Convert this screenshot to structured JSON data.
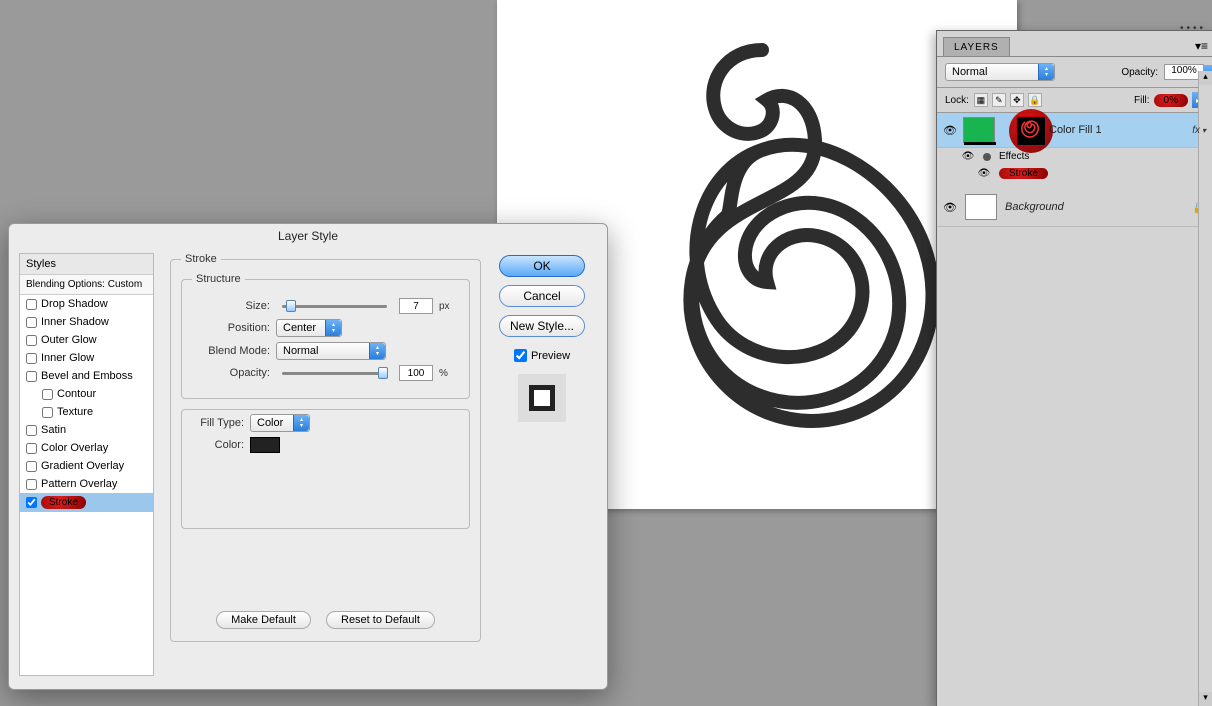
{
  "dialog": {
    "title": "Layer Style",
    "styles_header": "Styles",
    "blending_options": "Blending Options: Custom",
    "style_items": [
      {
        "label": "Drop Shadow",
        "checked": false
      },
      {
        "label": "Inner Shadow",
        "checked": false
      },
      {
        "label": "Outer Glow",
        "checked": false
      },
      {
        "label": "Inner Glow",
        "checked": false
      },
      {
        "label": "Bevel and Emboss",
        "checked": false
      },
      {
        "label": "Contour",
        "checked": false,
        "sub": true
      },
      {
        "label": "Texture",
        "checked": false,
        "sub": true
      },
      {
        "label": "Satin",
        "checked": false
      },
      {
        "label": "Color Overlay",
        "checked": false
      },
      {
        "label": "Gradient Overlay",
        "checked": false
      },
      {
        "label": "Pattern Overlay",
        "checked": false
      }
    ],
    "stroke_item": "Stroke",
    "fieldset_stroke": "Stroke",
    "fieldset_structure": "Structure",
    "size_label": "Size:",
    "size_value": "7",
    "size_unit": "px",
    "position_label": "Position:",
    "position_value": "Center",
    "blendmode_label": "Blend Mode:",
    "blendmode_value": "Normal",
    "opacity_label": "Opacity:",
    "opacity_value": "100",
    "opacity_unit": "%",
    "filltype_label": "Fill Type:",
    "filltype_value": "Color",
    "color_label": "Color:",
    "make_default": "Make Default",
    "reset_default": "Reset to Default",
    "ok": "OK",
    "cancel": "Cancel",
    "new_style": "New Style...",
    "preview": "Preview"
  },
  "layers_panel": {
    "tab": "LAYERS",
    "blend_mode": "Normal",
    "opacity_label": "Opacity:",
    "opacity_value": "100%",
    "lock_label": "Lock:",
    "fill_label": "Fill:",
    "fill_value": "0%",
    "layer1_name": "Color Fill 1",
    "fx": "fx",
    "effects_label": "Effects",
    "stroke_label": "Stroke",
    "background_label": "Background"
  }
}
